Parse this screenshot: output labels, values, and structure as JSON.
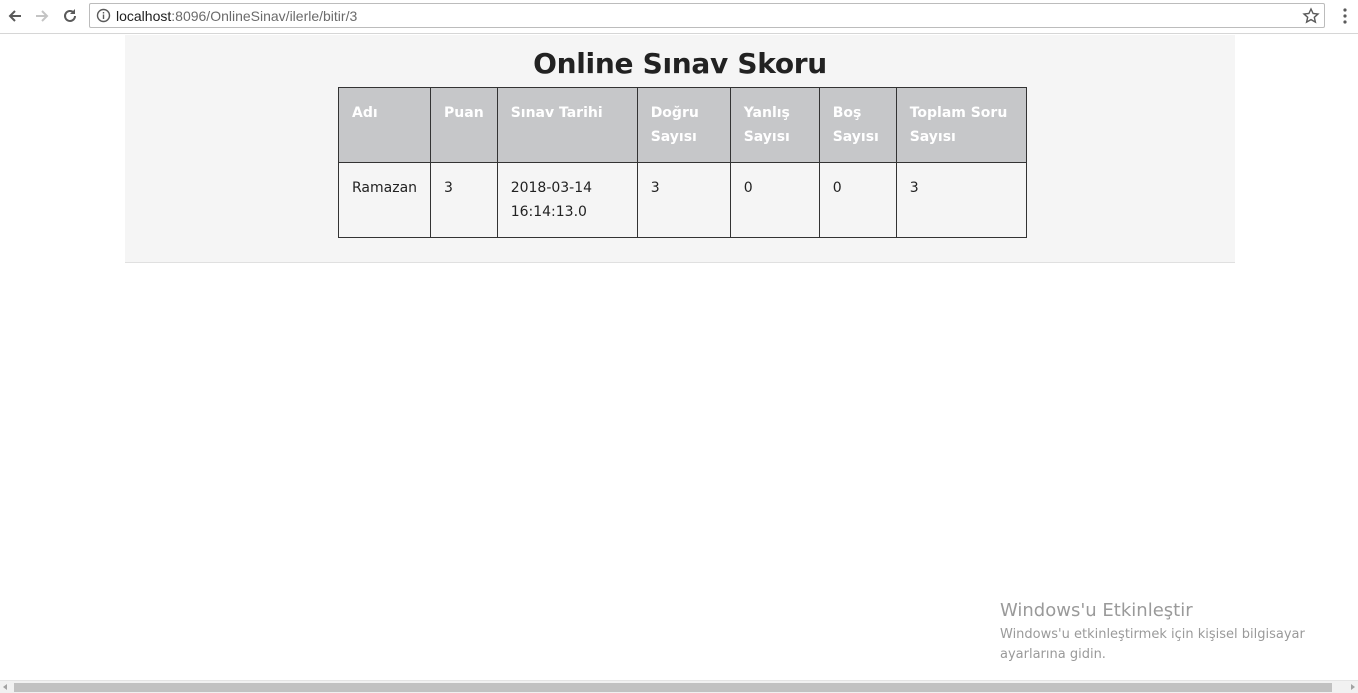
{
  "browser": {
    "url_host": "localhost",
    "url_rest": ":8096/OnlineSinav/ilerle/bitir/3"
  },
  "page": {
    "title": "Online Sınav Skoru"
  },
  "table": {
    "headers": [
      "Adı",
      "Puan",
      "Sınav Tarihi",
      "Doğru Sayısı",
      "Yanlış Sayısı",
      "Boş Sayısı",
      "Toplam Soru Sayısı"
    ],
    "rows": [
      [
        "Ramazan",
        "3",
        "2018-03-14 16:14:13.0",
        "3",
        "0",
        "0",
        "3"
      ]
    ]
  },
  "watermark": {
    "title": "Windows'u Etkinleştir",
    "subtitle": "Windows'u etkinleştirmek için kişisel bilgisayar ayarlarına gidin."
  },
  "colors": {
    "header_bg": "#c6c7c9",
    "jumbotron_bg": "#f5f5f5"
  }
}
